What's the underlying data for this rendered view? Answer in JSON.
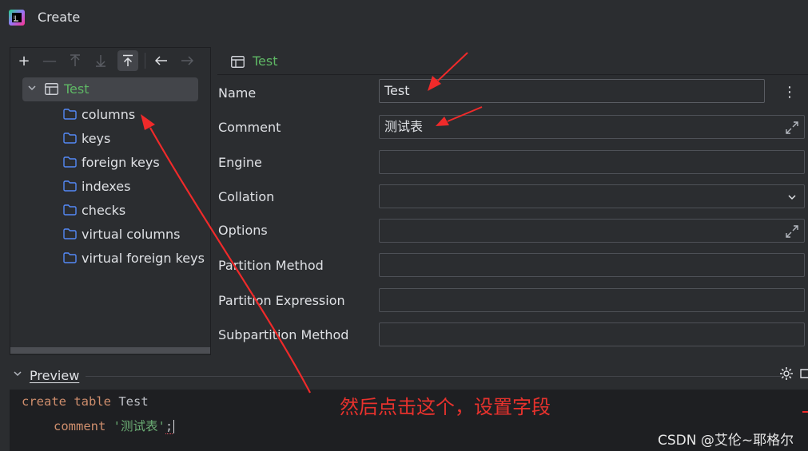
{
  "window": {
    "title": "Create",
    "logo_icon": "jetbrains-datagrip-icon"
  },
  "toolbar": {
    "buttons": [
      {
        "icon": "add-icon",
        "glyph": "+"
      },
      {
        "icon": "remove-icon",
        "glyph": "—"
      },
      {
        "icon": "move-up-icon",
        "glyph": "⤒"
      },
      {
        "icon": "move-down-icon",
        "glyph": "⤓"
      },
      {
        "icon": "move-to-top-icon",
        "glyph": "⤒"
      },
      {
        "icon": "back-icon",
        "glyph": "←"
      },
      {
        "icon": "forward-icon",
        "glyph": "→"
      }
    ]
  },
  "tree": {
    "root_label": "Test",
    "items": [
      {
        "label": "columns"
      },
      {
        "label": "keys"
      },
      {
        "label": "foreign keys"
      },
      {
        "label": "indexes"
      },
      {
        "label": "checks"
      },
      {
        "label": "virtual columns"
      },
      {
        "label": "virtual foreign keys"
      }
    ]
  },
  "form": {
    "header_label": "Test",
    "fields": [
      {
        "label": "Name",
        "value": "Test"
      },
      {
        "label": "Comment",
        "value": "测试表"
      },
      {
        "label": "Engine",
        "value": ""
      },
      {
        "label": "Collation",
        "value": ""
      },
      {
        "label": "Options",
        "value": ""
      },
      {
        "label": "Partition Method",
        "value": ""
      },
      {
        "label": "Partition Expression",
        "value": ""
      },
      {
        "label": "Subpartition Method",
        "value": ""
      }
    ]
  },
  "preview": {
    "label": "Preview",
    "code": {
      "kw_create_table": "create table",
      "table_name": "Test",
      "kw_comment": "comment",
      "comment_value": "'测试表'",
      "terminator": ";"
    }
  },
  "annotation": {
    "text": "然后点击这个，设置字段",
    "color": "#e8322d"
  },
  "watermark": {
    "text": "CSDN @艾伦~耶格尔"
  },
  "colors": {
    "background": "#2b2d30",
    "code_background": "#1e1f22",
    "accent_green": "#5fb865",
    "folder_blue": "#548af7",
    "selection": "#43454a"
  }
}
